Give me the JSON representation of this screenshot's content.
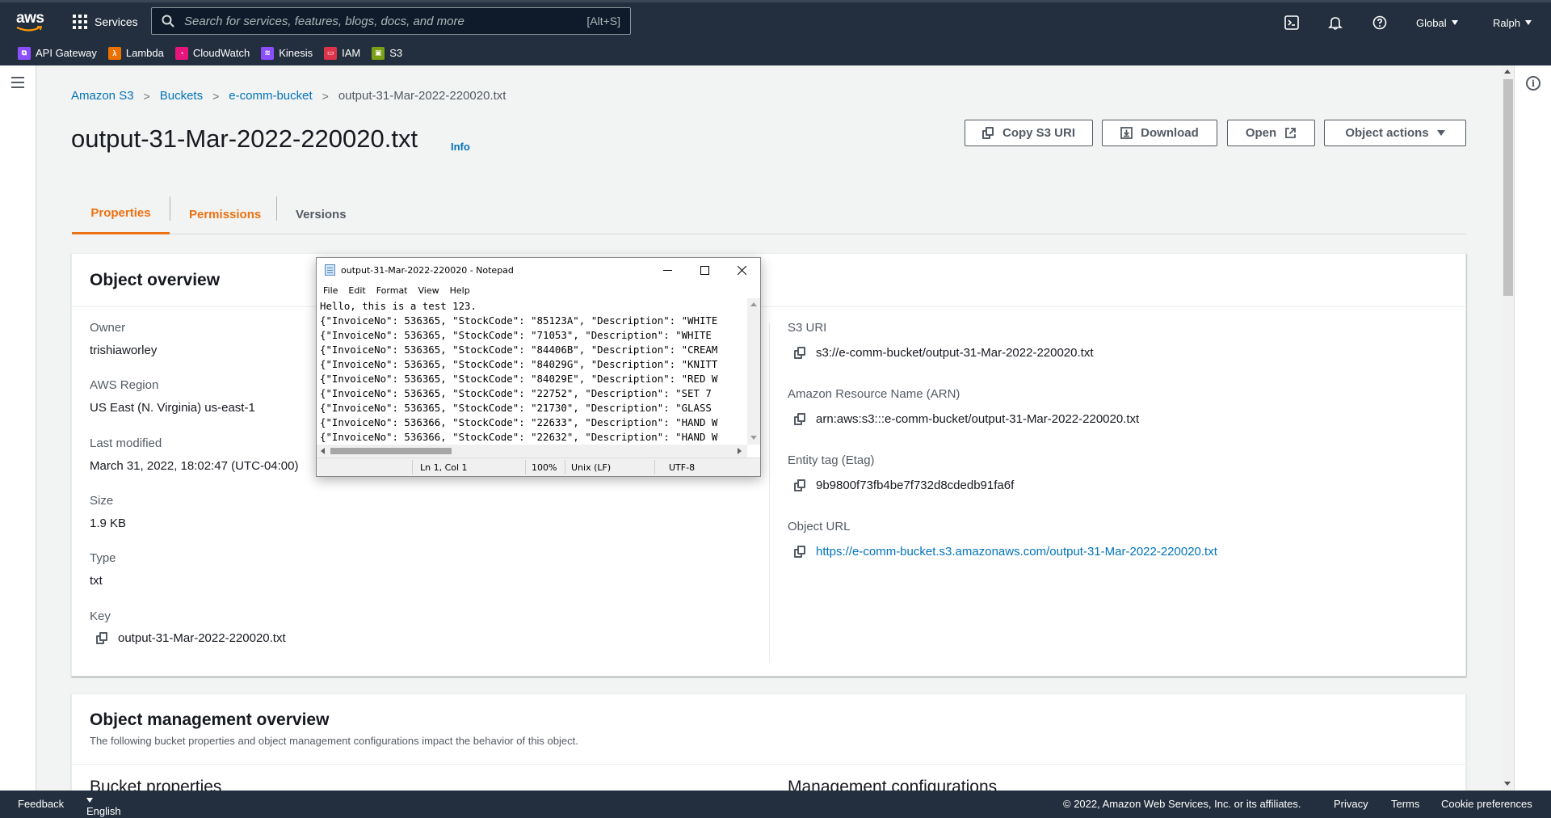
{
  "topnav": {
    "logo_text": "aws",
    "services_label": "Services",
    "search_placeholder": "Search for services, features, blogs, docs, and more",
    "search_shortcut": "[Alt+S]",
    "region_label": "Global",
    "user_label": "Ralph"
  },
  "favorites": [
    {
      "label": "API Gateway",
      "icon": "api-gateway-icon",
      "color": "#8c4fff"
    },
    {
      "label": "Lambda",
      "icon": "lambda-icon",
      "color": "#ed7100"
    },
    {
      "label": "CloudWatch",
      "icon": "cloudwatch-icon",
      "color": "#e7157b"
    },
    {
      "label": "Kinesis",
      "icon": "kinesis-icon",
      "color": "#8c4fff"
    },
    {
      "label": "IAM",
      "icon": "iam-icon",
      "color": "#dd344c"
    },
    {
      "label": "S3",
      "icon": "s3-icon",
      "color": "#7aa116"
    }
  ],
  "breadcrumb": {
    "items": [
      "Amazon S3",
      "Buckets",
      "e-comm-bucket"
    ],
    "current": "output-31-Mar-2022-220020.txt"
  },
  "header": {
    "title": "output-31-Mar-2022-220020.txt",
    "info": "Info",
    "buttons": {
      "copy_uri": "Copy S3 URI",
      "download": "Download",
      "open": "Open",
      "object_actions": "Object actions"
    }
  },
  "tabs": [
    "Properties",
    "Permissions",
    "Versions"
  ],
  "overview": {
    "title": "Object overview",
    "left": {
      "owner_label": "Owner",
      "owner": "trishiaworley",
      "region_label": "AWS Region",
      "region": "US East (N. Virginia) us-east-1",
      "modified_label": "Last modified",
      "modified": "March 31, 2022, 18:02:47 (UTC-04:00)",
      "size_label": "Size",
      "size": "1.9 KB",
      "type_label": "Type",
      "type": "txt",
      "key_label": "Key",
      "key": "output-31-Mar-2022-220020.txt"
    },
    "right": {
      "uri_label": "S3 URI",
      "uri": "s3://e-comm-bucket/output-31-Mar-2022-220020.txt",
      "arn_label": "Amazon Resource Name (ARN)",
      "arn": "arn:aws:s3:::e-comm-bucket/output-31-Mar-2022-220020.txt",
      "etag_label": "Entity tag (Etag)",
      "etag": "9b9800f73fb4be7f732d8cdedb91fa6f",
      "url_label": "Object URL",
      "url": "https://e-comm-bucket.s3.amazonaws.com/output-31-Mar-2022-220020.txt"
    }
  },
  "management": {
    "title": "Object management overview",
    "description": "The following bucket properties and object management configurations impact the behavior of this object.",
    "bucket_properties": "Bucket properties",
    "management_configurations": "Management configurations"
  },
  "footer": {
    "feedback": "Feedback",
    "language": "English (US)",
    "copyright": "© 2022, Amazon Web Services, Inc. or its affiliates.",
    "privacy": "Privacy",
    "terms": "Terms",
    "cookies": "Cookie preferences"
  },
  "notepad": {
    "title": "output-31-Mar-2022-220020 - Notepad",
    "menu": [
      "File",
      "Edit",
      "Format",
      "View",
      "Help"
    ],
    "lines": [
      "Hello, this is a test 123.",
      "{\"InvoiceNo\": 536365, \"StockCode\": \"85123A\", \"Description\": \"WHITE",
      "{\"InvoiceNo\": 536365, \"StockCode\": \"71053\", \"Description\": \"WHITE ",
      "{\"InvoiceNo\": 536365, \"StockCode\": \"84406B\", \"Description\": \"CREAM",
      "{\"InvoiceNo\": 536365, \"StockCode\": \"84029G\", \"Description\": \"KNITT",
      "{\"InvoiceNo\": 536365, \"StockCode\": \"84029E\", \"Description\": \"RED W",
      "{\"InvoiceNo\": 536365, \"StockCode\": \"22752\", \"Description\": \"SET 7",
      "{\"InvoiceNo\": 536365, \"StockCode\": \"21730\", \"Description\": \"GLASS",
      "{\"InvoiceNo\": 536366, \"StockCode\": \"22633\", \"Description\": \"HAND W",
      "{\"InvoiceNo\": 536366, \"StockCode\": \"22632\", \"Description\": \"HAND W"
    ],
    "status": {
      "position": "Ln 1, Col 1",
      "zoom": "100%",
      "line_endings": "Unix (LF)",
      "encoding": "UTF-8"
    }
  }
}
